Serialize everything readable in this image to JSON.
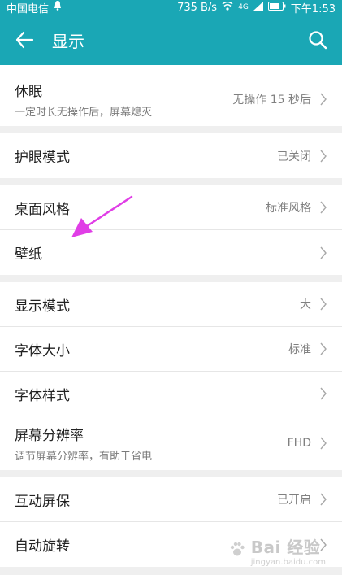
{
  "status": {
    "carrier": "中国电信",
    "speed": "735 B/s",
    "network": "4G",
    "time": "下午1:53"
  },
  "header": {
    "title": "显示"
  },
  "groups": [
    [
      {
        "label": "休眠",
        "sub": "一定时长无操作后，屏幕熄灭",
        "value": "无操作 15 秒后"
      }
    ],
    [
      {
        "label": "护眼模式",
        "value": "已关闭"
      }
    ],
    [
      {
        "label": "桌面风格",
        "value": "标准风格"
      },
      {
        "label": "壁纸",
        "value": ""
      }
    ],
    [
      {
        "label": "显示模式",
        "value": "大"
      },
      {
        "label": "字体大小",
        "value": "标准"
      },
      {
        "label": "字体样式",
        "value": ""
      },
      {
        "label": "屏幕分辨率",
        "sub": "调节屏幕分辨率，有助于省电",
        "value": "FHD"
      }
    ],
    [
      {
        "label": "互动屏保",
        "value": "已开启"
      },
      {
        "label": "自动旋转",
        "value": ""
      }
    ]
  ],
  "watermark": {
    "text": "Bai 经验",
    "sub": "jingyan.baidu.com"
  },
  "colors": {
    "accent": "#1aa7b5",
    "annotation": "#e03ee6"
  }
}
